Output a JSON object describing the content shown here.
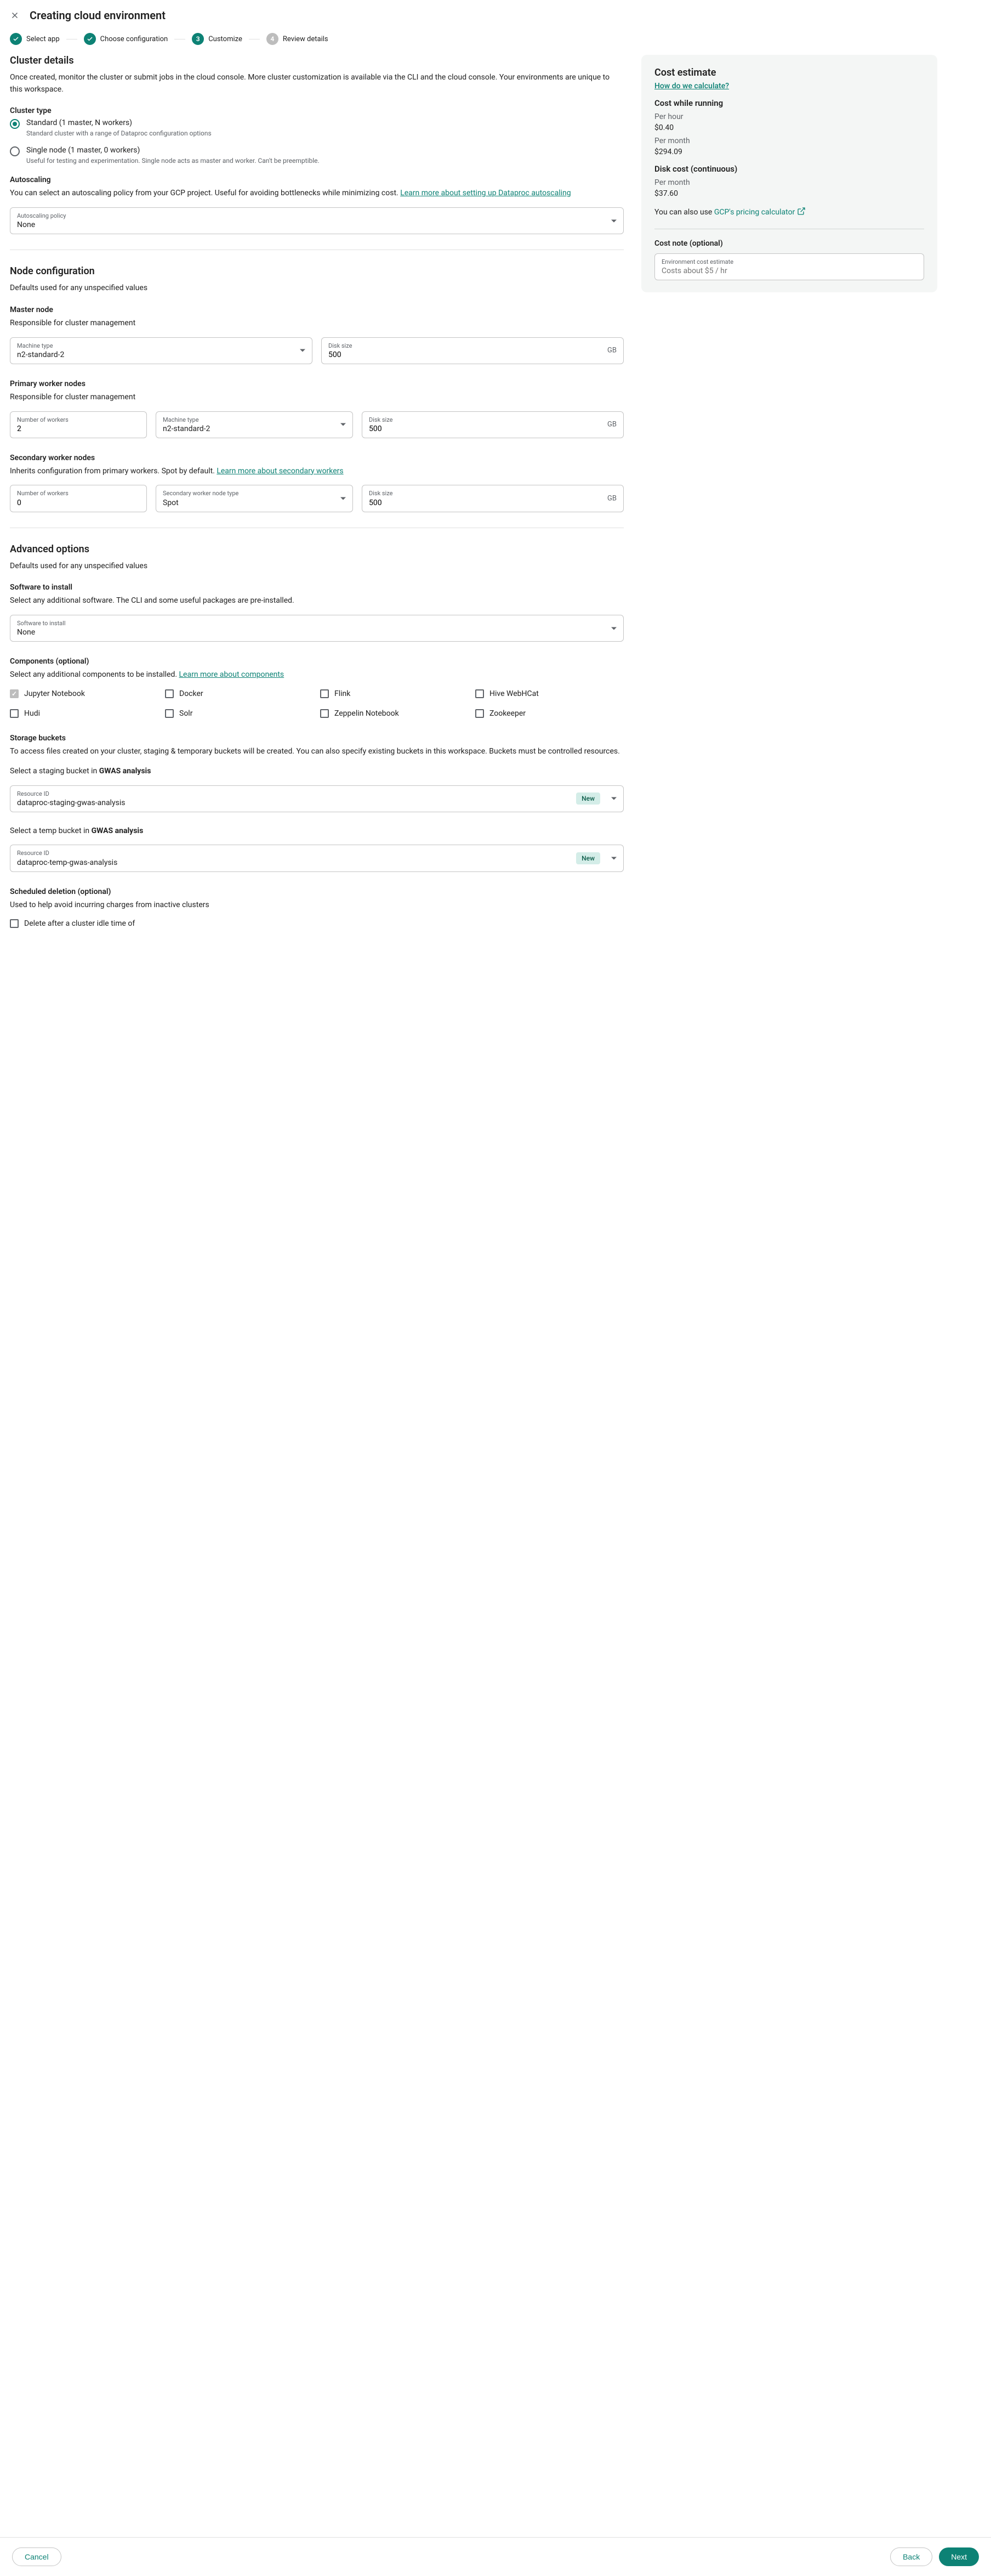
{
  "header": {
    "title": "Creating cloud environment"
  },
  "stepper": {
    "steps": [
      {
        "label": "Select app",
        "state": "done"
      },
      {
        "label": "Choose configuration",
        "state": "done"
      },
      {
        "label": "Customize",
        "state": "active",
        "num": "3"
      },
      {
        "label": "Review details",
        "state": "pending",
        "num": "4"
      }
    ]
  },
  "cluster": {
    "title": "Cluster details",
    "desc": "Once created, monitor the cluster or submit jobs in the cloud console. More cluster customization is available via the CLI and the cloud console. Your environments are unique to this workspace.",
    "type_heading": "Cluster type",
    "options": [
      {
        "label": "Standard (1 master, N workers)",
        "helper": "Standard cluster with a range of Dataproc configuration options",
        "selected": true
      },
      {
        "label": "Single node (1 master, 0 workers)",
        "helper": "Useful for testing and experimentation. Single node acts as master and worker. Can't be preemptible.",
        "selected": false
      }
    ]
  },
  "autoscaling": {
    "heading": "Autoscaling",
    "desc_pre": "You can select an autoscaling policy from your GCP project. Useful for avoiding bottlenecks while minimizing cost. ",
    "link": "Learn more about setting up Dataproc autoscaling",
    "field_label": "Autoscaling policy",
    "field_value": "None"
  },
  "node": {
    "title": "Node configuration",
    "desc": "Defaults used for any unspecified values",
    "master": {
      "heading": "Master node",
      "sub": "Responsible for cluster management",
      "machine_label": "Machine type",
      "machine_value": "n2-standard-2",
      "disk_label": "Disk size",
      "disk_value": "500",
      "disk_unit": "GB"
    },
    "primary": {
      "heading": "Primary worker nodes",
      "sub": "Responsible for cluster management",
      "count_label": "Number of workers",
      "count_value": "2",
      "machine_label": "Machine type",
      "machine_value": "n2-standard-2",
      "disk_label": "Disk size",
      "disk_value": "500",
      "disk_unit": "GB"
    },
    "secondary": {
      "heading": "Secondary worker nodes",
      "sub_pre": "Inherits configuration from primary workers. Spot by default. ",
      "sub_link": "Learn more about secondary workers",
      "count_label": "Number of workers",
      "count_value": "0",
      "type_label": "Secondary worker node type",
      "type_value": "Spot",
      "disk_label": "Disk size",
      "disk_value": "500",
      "disk_unit": "GB"
    }
  },
  "advanced": {
    "title": "Advanced options",
    "desc": "Defaults used for any unspecified values",
    "software": {
      "heading": "Software to install",
      "sub": "Select any additional software. The CLI and some useful packages are pre-installed.",
      "field_label": "Software to install",
      "field_value": "None"
    },
    "components": {
      "heading": "Components (optional)",
      "sub_pre": "Select any additional components to be installed. ",
      "sub_link": "Learn more about components",
      "items": [
        {
          "label": "Jupyter Notebook",
          "checked": true,
          "disabled": true
        },
        {
          "label": "Docker",
          "checked": false
        },
        {
          "label": "Flink",
          "checked": false
        },
        {
          "label": "Hive WebHCat",
          "checked": false
        },
        {
          "label": "Hudi",
          "checked": false
        },
        {
          "label": "Solr",
          "checked": false
        },
        {
          "label": "Zeppelin Notebook",
          "checked": false
        },
        {
          "label": "Zookeeper",
          "checked": false
        }
      ]
    },
    "storage": {
      "heading": "Storage buckets",
      "sub": "To access files created on your cluster, staging & temporary buckets will be created. You can also specify existing buckets in this workspace. Buckets must be controlled resources.",
      "staging_prompt_pre": "Select a staging bucket in ",
      "staging_prompt_bold": "GWAS analysis",
      "staging_label": "Resource ID",
      "staging_value": "dataproc-staging-gwas-analysis",
      "temp_prompt_pre": "Select a temp bucket in ",
      "temp_prompt_bold": "GWAS analysis",
      "temp_label": "Resource ID",
      "temp_value": "dataproc-temp-gwas-analysis",
      "new_badge": "New"
    },
    "deletion": {
      "heading": "Scheduled deletion (optional)",
      "sub": "Used to help avoid incurring charges from inactive clusters",
      "checkbox_label": "Delete after a cluster idle time of"
    }
  },
  "cost": {
    "title": "Cost estimate",
    "calc_link": "How do we calculate?",
    "running_heading": "Cost while running",
    "per_hour_label": "Per hour",
    "per_hour_val": "$0.40",
    "per_month_label": "Per month",
    "per_month_val": "$294.09",
    "disk_heading": "Disk cost (continuous)",
    "disk_month_label": "Per month",
    "disk_month_val": "$37.60",
    "also_pre": "You can also use ",
    "also_link": "GCP's pricing calculator",
    "note_heading": "Cost note (optional)",
    "note_label": "Environment cost estimate",
    "note_placeholder": "Costs about $5 / hr"
  },
  "footer": {
    "cancel": "Cancel",
    "back": "Back",
    "next": "Next"
  }
}
